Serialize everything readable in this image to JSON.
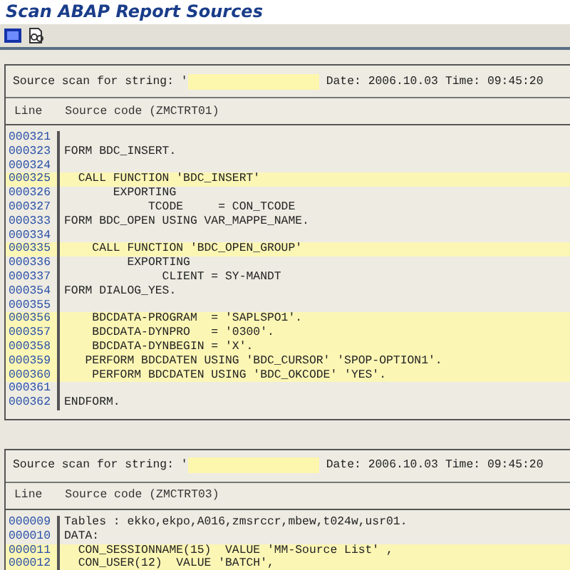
{
  "window": {
    "title": "Scan ABAP Report Sources"
  },
  "toolbar": [
    {
      "kind": "grid"
    },
    {
      "kind": "glasses"
    }
  ],
  "panels": [
    {
      "scan_label": "Source scan for string: '",
      "date": "Date: 2006.10.03",
      "time": "Time: 09:45:20",
      "col_line": "Line",
      "col_source": "Source code (ZMCTRT01)",
      "rows": [
        {
          "line": "000321",
          "code": "",
          "highlighted": false
        },
        {
          "line": "000323",
          "code": "FORM BDC_INSERT.",
          "highlighted": false
        },
        {
          "line": "000324",
          "code": "",
          "highlighted": false
        },
        {
          "line": "000325",
          "code": "  CALL FUNCTION 'BDC_INSERT'",
          "highlighted": true
        },
        {
          "line": "000326",
          "code": "       EXPORTING",
          "highlighted": false
        },
        {
          "line": "000327",
          "code": "            TCODE     = CON_TCODE",
          "highlighted": false
        },
        {
          "line": "000333",
          "code": "FORM BDC_OPEN USING VAR_MAPPE_NAME.",
          "highlighted": false
        },
        {
          "line": "000334",
          "code": "",
          "highlighted": false
        },
        {
          "line": "000335",
          "code": "    CALL FUNCTION 'BDC_OPEN_GROUP'",
          "highlighted": true
        },
        {
          "line": "000336",
          "code": "         EXPORTING",
          "highlighted": false
        },
        {
          "line": "000337",
          "code": "              CLIENT = SY-MANDT",
          "highlighted": false
        },
        {
          "line": "000354",
          "code": "FORM DIALOG_YES.",
          "highlighted": false
        },
        {
          "line": "000355",
          "code": "",
          "highlighted": false
        },
        {
          "line": "000356",
          "code": "    BDCDATA-PROGRAM  = 'SAPLSPO1'.",
          "highlighted": true
        },
        {
          "line": "000357",
          "code": "    BDCDATA-DYNPRO   = '0300'.",
          "highlighted": true
        },
        {
          "line": "000358",
          "code": "    BDCDATA-DYNBEGIN = 'X'.",
          "highlighted": true
        },
        {
          "line": "000359",
          "code": "   PERFORM BDCDATEN USING 'BDC_CURSOR' 'SPOP-OPTION1'.",
          "highlighted": true
        },
        {
          "line": "000360",
          "code": "    PERFORM BDCDATEN USING 'BDC_OKCODE' 'YES'.",
          "highlighted": true
        },
        {
          "line": "000361",
          "code": "",
          "highlighted": false
        },
        {
          "line": "000362",
          "code": "ENDFORM.",
          "highlighted": false
        }
      ]
    },
    {
      "scan_label": "Source scan for string: '",
      "date": "Date: 2006.10.03",
      "time": "Time: 09:45:20",
      "col_line": "Line",
      "col_source": "Source code (ZMCTRT03)",
      "rows": [
        {
          "line": "000009",
          "code": "Tables : ekko,ekpo,A016,zmsrccr,mbew,t024w,usr01.",
          "highlighted": false
        },
        {
          "line": "000010",
          "code": "DATA:",
          "highlighted": false
        },
        {
          "line": "000011",
          "code": "  CON_SESSIONNAME(15)  VALUE 'MM-Source List' ,",
          "highlighted": true
        },
        {
          "line": "000012",
          "code": "  CON_USER(12)  VALUE 'BATCH',",
          "highlighted": true
        }
      ]
    }
  ]
}
